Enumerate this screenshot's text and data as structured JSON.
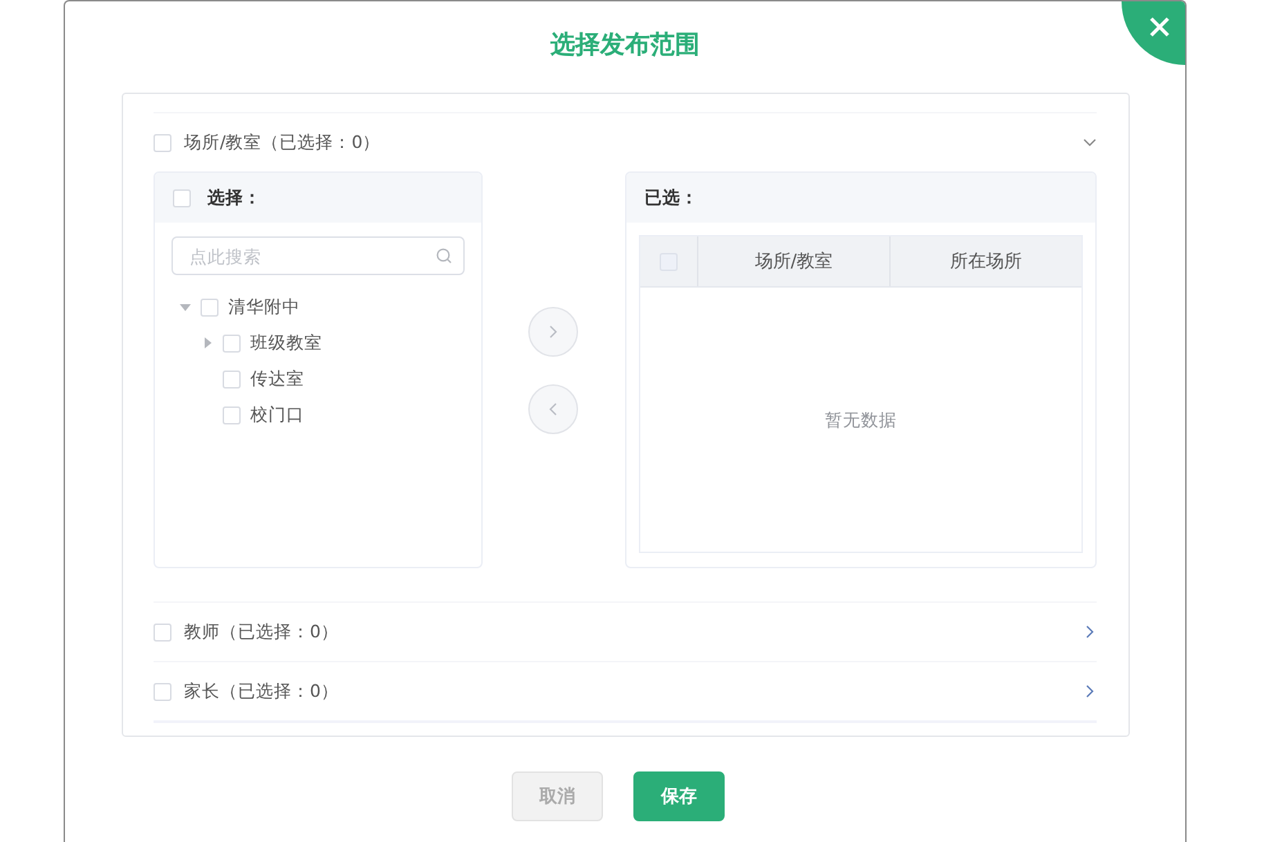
{
  "title": "选择发布范围",
  "sections": [
    {
      "label": "场所/教室（已选择：0）",
      "checked": false,
      "expanded": true,
      "transfer": {
        "source": {
          "header": "选择：",
          "checked": false,
          "search_placeholder": "点此搜索",
          "tree": [
            {
              "label": "清华附中",
              "checked": false,
              "expanded": true,
              "children": [
                {
                  "label": "班级教室",
                  "checked": false,
                  "expanded": false
                },
                {
                  "label": "传达室",
                  "checked": false
                },
                {
                  "label": "校门口",
                  "checked": false
                }
              ]
            }
          ]
        },
        "target": {
          "header": "已选：",
          "header_checked": false,
          "columns": [
            "场所/教室",
            "所在场所"
          ],
          "empty_text": "暂无数据"
        }
      }
    },
    {
      "label": "教师（已选择：0）",
      "checked": false,
      "expanded": false
    },
    {
      "label": "家长（已选择：0）",
      "checked": false,
      "expanded": false
    }
  ],
  "buttons": [
    {
      "label": "取消",
      "kind": "secondary"
    },
    {
      "label": "保存",
      "kind": "primary"
    }
  ]
}
